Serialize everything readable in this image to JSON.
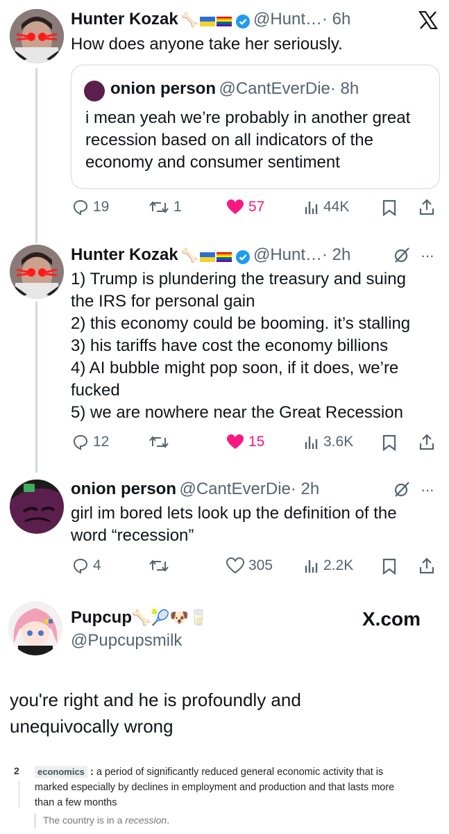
{
  "tweet1": {
    "name": "Hunter Kozak",
    "handle": "@Hunt…",
    "time": "· 6h",
    "text": "How does anyone take her seriously.",
    "quote": {
      "name": "onion person",
      "handle": "@CantEverDie",
      "time": "· 8h",
      "text": "i mean yeah we’re probably in another great recession based on all indicators of the economy and consumer sentiment"
    },
    "stats": {
      "replies": "19",
      "reposts": "1",
      "likes": "57",
      "views": "44K"
    }
  },
  "tweet2": {
    "name": "Hunter Kozak",
    "handle": "@Hunt…",
    "time": "· 2h",
    "lines": [
      "1) Trump is plundering the treasury and suing",
      "the IRS for personal gain",
      "2) this economy could be booming. it’s stalling",
      "3) his tariffs have cost the economy billions",
      "4) AI bubble might pop soon, if it does, we’re",
      "fucked",
      "5) we are nowhere near the Great Recession"
    ],
    "stats": {
      "replies": "12",
      "reposts": "",
      "likes": "15",
      "views": "3.6K"
    }
  },
  "tweet3": {
    "name": "onion person",
    "handle": "@CantEverDie",
    "time": "· 2h",
    "lines": [
      "girl im bored lets look up the definition of the",
      "word “recession”"
    ],
    "stats": {
      "replies": "4",
      "reposts": "",
      "likes": "305",
      "views": "2.2K"
    }
  },
  "card": {
    "name": "Pupcup",
    "handle": "@Pupcupsmilk",
    "brand": "X.com",
    "lines": [
      "you're right and he is profoundly and",
      "unequivocally  wrong"
    ]
  },
  "definition": {
    "number": "2",
    "label": "economics",
    "sep": " : ",
    "text1": "a period of significantly reduced general economic activity that is",
    "text2": "marked especially by declines in employment and production and that lasts more",
    "text3": "than a few months",
    "example_prefix": "The country is in a ",
    "example_word": "recession",
    "example_suffix": "."
  },
  "colors": {
    "like": "#f91880",
    "verified": "#1d9bf0",
    "muted": "#536471"
  }
}
